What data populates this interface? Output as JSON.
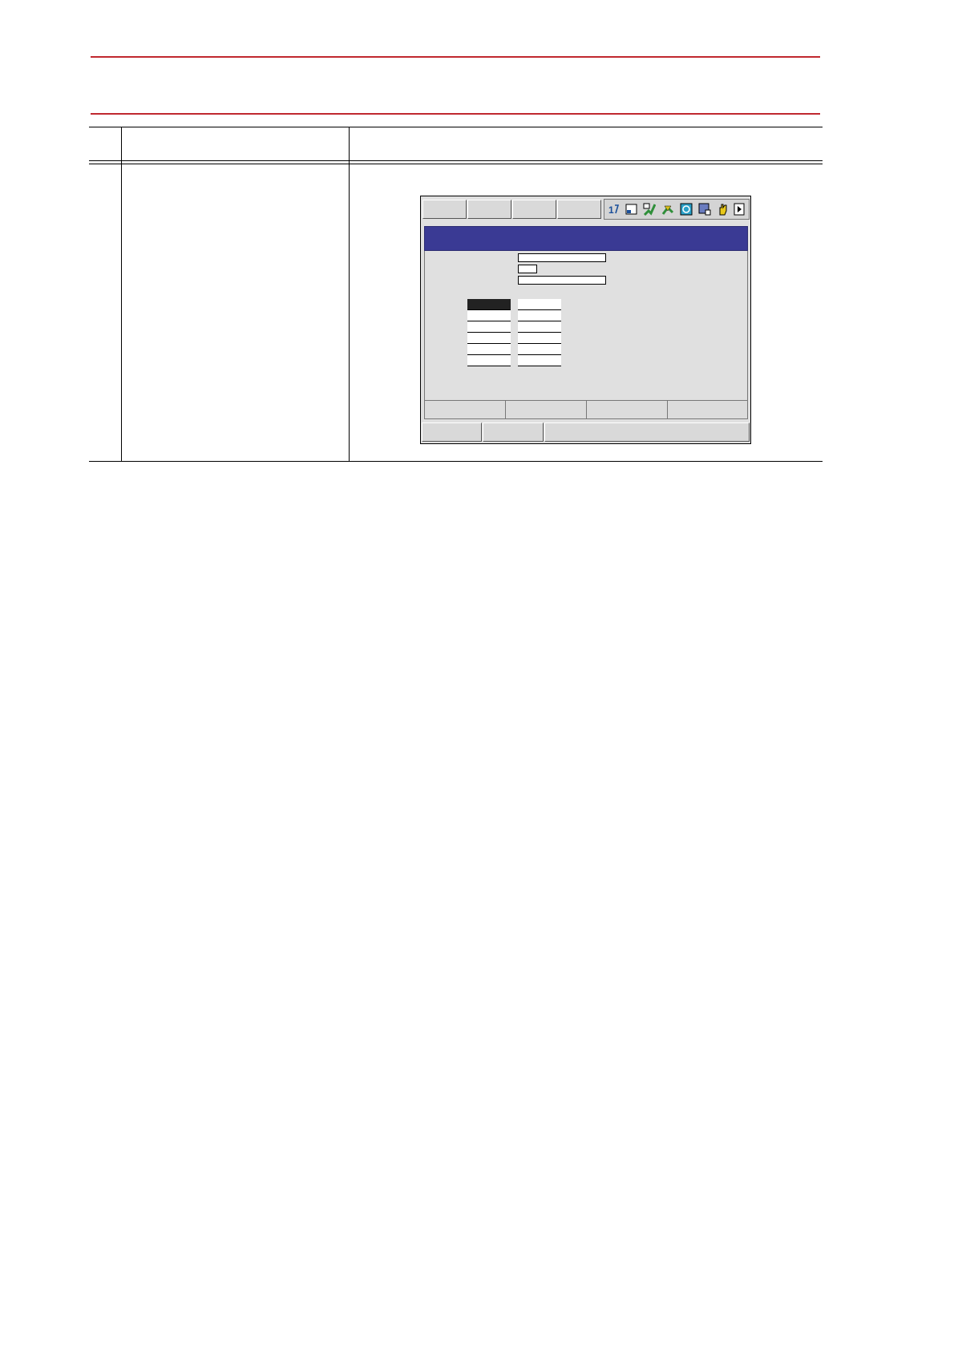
{
  "header": {
    "title": ""
  },
  "table": {
    "columns": [
      "",
      "",
      ""
    ],
    "rows": [
      {
        "step": "",
        "operation": "",
        "explanation": ""
      }
    ]
  },
  "pendant": {
    "menu_tabs": [
      "",
      "",
      "",
      ""
    ],
    "status_icons": [
      "cycle-icon",
      "window-icon",
      "servo-icon",
      "tool-icon",
      "playback-icon",
      "monitor-icon",
      "hand-icon",
      "play-icon"
    ],
    "title": "",
    "fields": [
      "",
      "",
      ""
    ],
    "table_left": [
      "",
      "",
      "",
      "",
      "",
      ""
    ],
    "table_right": [
      "",
      "",
      "",
      "",
      "",
      ""
    ],
    "soft_keys": [
      "",
      "",
      "",
      ""
    ],
    "bottom_buttons": [
      "",
      ""
    ],
    "message": "",
    "colors": {
      "title_bar": "#3a3a94",
      "panel": "#e0e0e0",
      "icon_accent": "#2aa0c8",
      "icon_green": "#2f8f3a"
    }
  }
}
